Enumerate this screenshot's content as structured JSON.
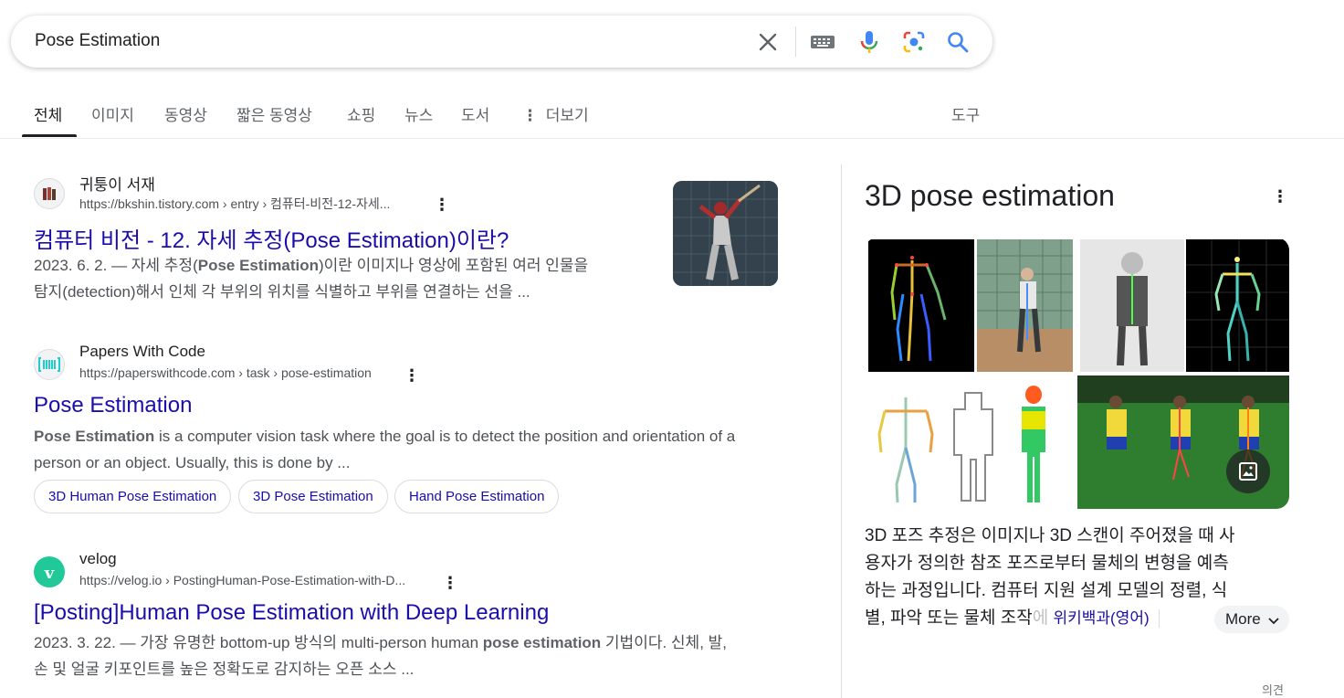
{
  "search": {
    "query": "Pose Estimation"
  },
  "tabs": [
    {
      "label": "전체"
    },
    {
      "label": "이미지"
    },
    {
      "label": "동영상"
    },
    {
      "label": "짧은 동영상"
    },
    {
      "label": "쇼핑"
    },
    {
      "label": "뉴스"
    },
    {
      "label": "도서"
    },
    {
      "label": "더보기"
    }
  ],
  "tools_label": "도구",
  "results": [
    {
      "site": "귀퉁이 서재",
      "url": "https://bkshin.tistory.com › entry › 컴퓨터-비전-12-자세...",
      "title": "컴퓨터 비전 - 12. 자세 추정(Pose Estimation)이란?",
      "snippet_line1": {
        "pre": "2023. 6. 2. — 자세 추정(",
        "bold": "Pose Estimation",
        "post": ")이란 이미지나 영상에 포함된 여러 인물을"
      },
      "snippet_line2": "탐지(detection)해서 인체 각 부위의 위치를 식별하고 부위를 연결하는 선을 ..."
    },
    {
      "site": "Papers With Code",
      "url": "https://paperswithcode.com › task › pose-estimation",
      "title": "Pose Estimation",
      "snippet_line1": {
        "bold": "Pose Estimation",
        "post": " is a computer vision task where the goal is to detect the position and orientation of a"
      },
      "snippet_line2": "person or an object. Usually, this is done by ...",
      "chips": [
        "3D Human Pose Estimation",
        "3D Pose Estimation",
        "Hand Pose Estimation"
      ]
    },
    {
      "site": "velog",
      "url": "https://velog.io › PostingHuman-Pose-Estimation-with-D...",
      "title": "[Posting]Human Pose Estimation with Deep Learning",
      "snippet_line1": {
        "pre": "2023. 3. 22. — 가장 유명한 bottom-up 방식의 multi-person human ",
        "bold": "pose estimation",
        "post": " 기법이다. 신체, 발,"
      },
      "snippet_line2": "손 및 얼굴 키포인트를 높은 정확도로 감지하는 오픈 소스 ..."
    }
  ],
  "knowledge_panel": {
    "title": "3D pose estimation",
    "desc_line1": "3D 포즈 추정은 이미지나 3D 스캔이 주어졌을 때 사",
    "desc_line2": "용자가 정의한 참조 포즈로부터 물체의 변형을 예측",
    "desc_line3": "하는 과정입니다. 컴퓨터 지원 설계 모델의 정렬, 식",
    "desc_line4": "별, 파악 또는 물체 조작",
    "desc_fade": "에 ",
    "wiki_label": "위키백과(영어)",
    "more_label": "More",
    "feedback_label": "의견"
  },
  "colors": {
    "link": "#1a0dab",
    "text": "#202124",
    "muted": "#4d5156"
  }
}
